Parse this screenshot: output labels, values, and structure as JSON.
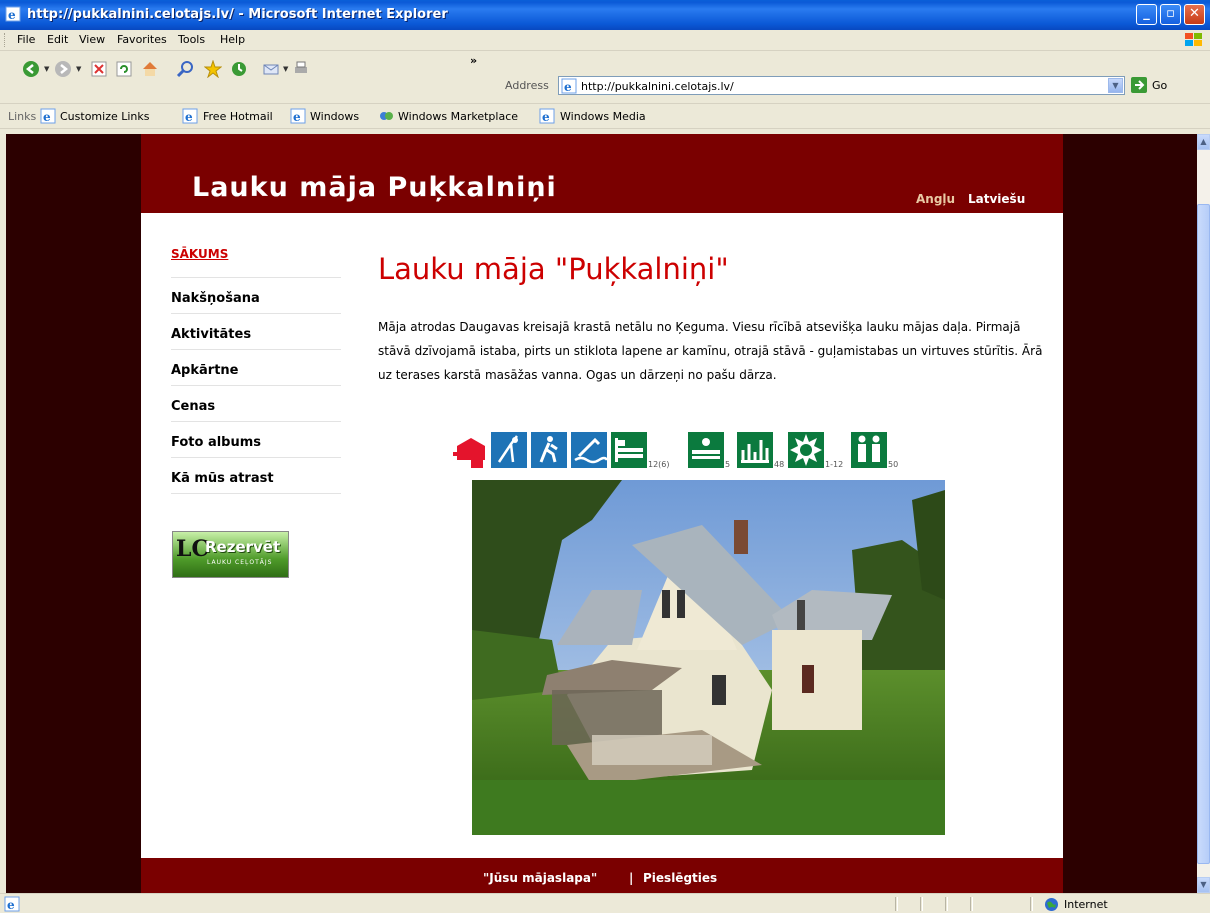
{
  "window": {
    "title": "http://pukkalnini.celotajs.lv/ - Microsoft Internet Explorer"
  },
  "menu": [
    "File",
    "Edit",
    "View",
    "Favorites",
    "Tools",
    "Help"
  ],
  "toolbar": {
    "chevron": "»",
    "address_label": "Address",
    "address_value": "http://pukkalnini.celotajs.lv/",
    "go_label": "Go"
  },
  "links": {
    "label": "Links",
    "items": [
      "Customize Links",
      "Free Hotmail",
      "Windows",
      "Windows Marketplace",
      "Windows Media"
    ]
  },
  "site": {
    "title": "Lauku māja Puķkalniņi",
    "lang_en": "Angļu",
    "lang_lv": "Latviešu"
  },
  "nav": [
    "SĀKUMS",
    "Nakšņošana",
    "Aktivitātes",
    "Apkārtne",
    "Cenas",
    "Foto albums",
    "Kā mūs atrast"
  ],
  "reserve": {
    "label": "Rezervēt",
    "logo": "LC",
    "sub": "LAUKU CEĻOTĀJS"
  },
  "main": {
    "title": "Lauku māja \"Puķkalniņi\"",
    "text": "Māja atrodas Daugavas kreisajā krastā netālu no Ķeguma. Viesu rīcībā atsevišķa lauku mājas daļa. Pirmajā stāvā dzīvojamā istaba, pirts un stiklota lapene ar kamīnu, otrajā stāvā - guļamistabas un virtuves stūrītis. Ārā uz terases karstā masāžas vanna. Ogas un dārzeņi no pašu dārza."
  },
  "facilities": {
    "beds": "12(6)",
    "extra_beds": "5",
    "seats": "48",
    "months": "1-12",
    "people": "50"
  },
  "footer": {
    "homepage": "\"Jūsu mājaslapa\"",
    "sep": "|",
    "login": "Pieslēgties"
  },
  "status": {
    "zone": "Internet"
  },
  "colors": {
    "header": "#7a0000",
    "accent": "#cc0000",
    "side": "#2c0000"
  }
}
